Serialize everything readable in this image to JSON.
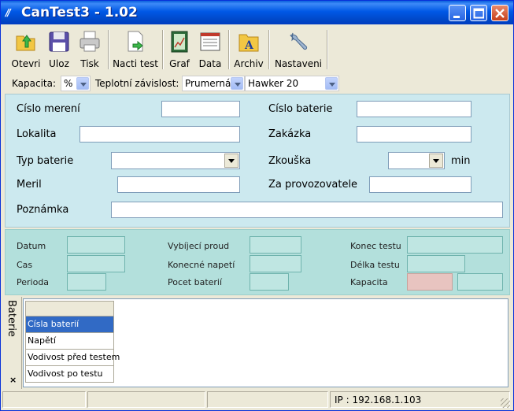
{
  "window": {
    "title": "CanTest3 - 1.02"
  },
  "toolbar": {
    "items": [
      {
        "label": "Otevri",
        "icon": "open-folder-icon"
      },
      {
        "label": "Uloz",
        "icon": "save-disk-icon"
      },
      {
        "label": "Tisk",
        "icon": "printer-icon"
      },
      {
        "label": "Nacti test",
        "icon": "load-document-icon"
      },
      {
        "label": "Graf",
        "icon": "chart-icon"
      },
      {
        "label": "Data",
        "icon": "data-sheet-icon"
      },
      {
        "label": "Archiv",
        "icon": "archive-folder-icon"
      },
      {
        "label": "Nastaveni",
        "icon": "settings-wrench-icon"
      }
    ]
  },
  "combostrip": {
    "kapacita_label": "Kapacita:",
    "kapacita_value": "%",
    "teplotni_label": "Teplotní závislost:",
    "teplotni_value": "Prumerná",
    "battery_value": "Hawker 20"
  },
  "form": {
    "cislo_mereni": "Císlo merení",
    "cislo_baterie": "Císlo baterie",
    "lokalita": "Lokalita",
    "zakazka": "Zakázka",
    "typ_baterie": "Typ baterie",
    "zkouska": "Zkouška",
    "min": "min",
    "meril": "Meril",
    "za_provozovatele": "Za provozovatele",
    "poznamka": "Poznámka"
  },
  "summary": {
    "datum": "Datum",
    "cas": "Cas",
    "perioda": "Perioda",
    "vybijeci_proud": "Vybíjecí proud",
    "konecne_napeti": "Konecné napetí",
    "pocet_baterii": "Pocet baterií",
    "konec_testu": "Konec testu",
    "delka_testu": "Délka testu",
    "kapacita": "Kapacita"
  },
  "batteries_panel": {
    "tab_label": "Baterie",
    "close_glyph": "×",
    "rows": [
      "Císla baterií",
      "Napětí",
      "Vodivost před testem",
      "Vodivost po testu"
    ]
  },
  "status": {
    "ip": "IP : 192.168.1.103"
  },
  "colors": {
    "form_bg": "#cce9ef",
    "summary_bg": "#b3e0dc",
    "kapacita_box": "#e8c4c0",
    "selection": "#316ac5"
  }
}
